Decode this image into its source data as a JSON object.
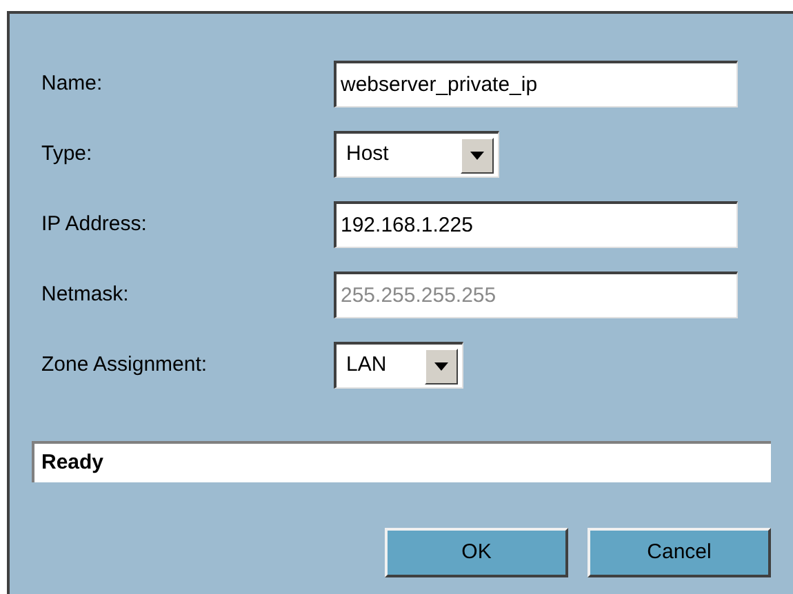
{
  "fields": [
    {
      "label": "Name:",
      "kind": "text",
      "value": "webserver_private_ip",
      "disabled": false
    },
    {
      "label": "Type:",
      "kind": "select",
      "value": "Host",
      "disabled": false
    },
    {
      "label": "IP Address:",
      "kind": "text",
      "value": "192.168.1.225",
      "disabled": false
    },
    {
      "label": "Netmask:",
      "kind": "text",
      "value": "255.255.255.255",
      "disabled": true
    },
    {
      "label": "Zone Assignment:",
      "kind": "select",
      "value": "LAN",
      "disabled": false
    }
  ],
  "status_bar": "Ready",
  "buttons": [
    "OK",
    "Cancel"
  ]
}
